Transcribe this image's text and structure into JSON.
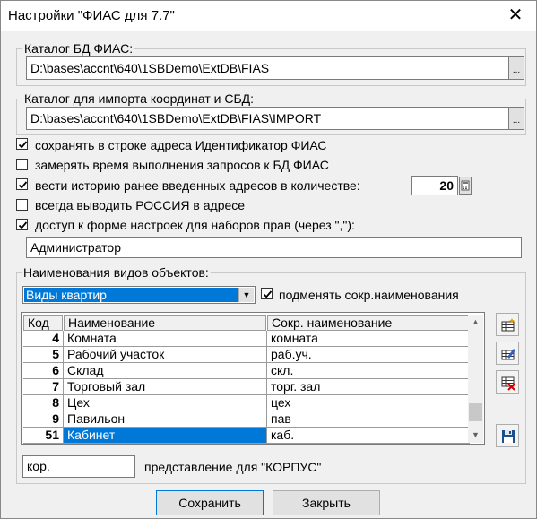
{
  "window": {
    "title": "Настройки \"ФИАС для 7.7\"",
    "close_glyph": "✕"
  },
  "db_catalog": {
    "label": "Каталог БД ФИАС:",
    "value": "D:\\bases\\accnt\\640\\1SBDemo\\ExtDB\\FIAS",
    "browse_label": "..."
  },
  "import_catalog": {
    "label": "Каталог для импорта координат и СБД:",
    "value": "D:\\bases\\accnt\\640\\1SBDemo\\ExtDB\\FIAS\\IMPORT",
    "browse_label": "..."
  },
  "options": [
    {
      "label": "сохранять в строке адреса Идентификатор ФИАС",
      "checked": true
    },
    {
      "label": "замерять время выполнения запросов к БД ФИАС",
      "checked": false
    },
    {
      "label": "вести историю ранее введенных адресов в количестве:",
      "checked": true
    },
    {
      "label": "всегда выводить РОССИЯ в адресе",
      "checked": false
    },
    {
      "label": "доступ к форме настроек для наборов прав (через \",\"):",
      "checked": true
    }
  ],
  "history_count": "20",
  "rights_value": "Администратор",
  "object_names": {
    "label": "Наименования видов объектов:",
    "combo_value": "Виды квартир",
    "replace_label": "подменять сокр.наименования",
    "replace_checked": true,
    "columns": [
      "Код",
      "Наименование",
      "Сокр. наименование"
    ],
    "rows": [
      {
        "code": "4",
        "name": "Комната",
        "short": "комната"
      },
      {
        "code": "5",
        "name": "Рабочий участок",
        "short": "раб.уч."
      },
      {
        "code": "6",
        "name": "Склад",
        "short": "скл."
      },
      {
        "code": "7",
        "name": "Торговый зал",
        "short": "торг. зал"
      },
      {
        "code": "8",
        "name": "Цех",
        "short": "цех"
      },
      {
        "code": "9",
        "name": "Павильон",
        "short": "пав"
      },
      {
        "code": "51",
        "name": "Кабинет",
        "short": "каб."
      }
    ],
    "selected_row": 6,
    "scroll_position": 0.92
  },
  "korpus": {
    "value": "кор.",
    "label": "представление для \"КОРПУС\""
  },
  "buttons": {
    "save": "Сохранить",
    "close": "Закрыть"
  },
  "colors": {
    "selection": "#0078d7",
    "window_bg": "#f0f0f0"
  }
}
